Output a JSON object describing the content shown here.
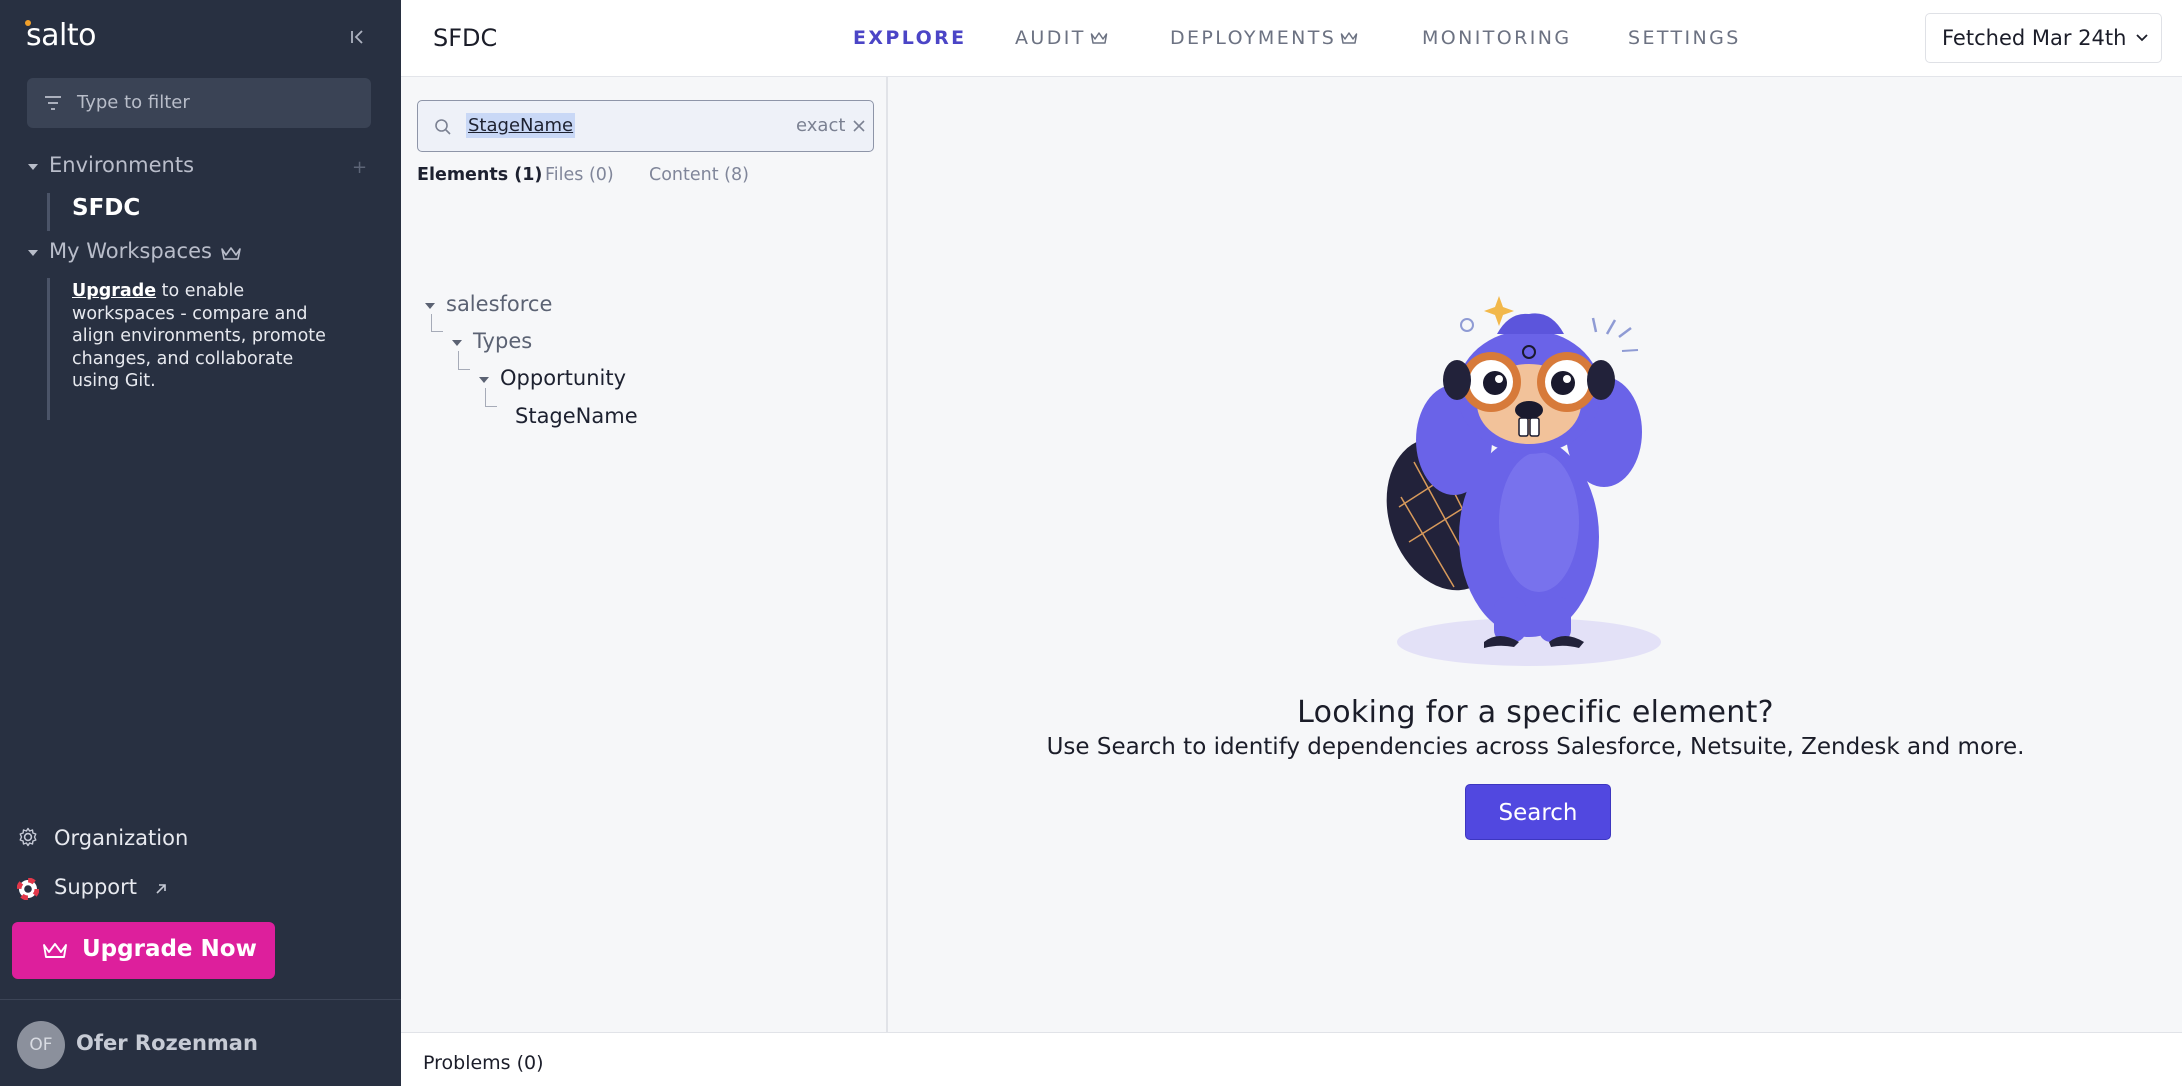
{
  "sidebar": {
    "logo_text": "salto",
    "filter_placeholder": "Type to filter",
    "environments_label": "Environments",
    "environments_add": "+",
    "environment_items": [
      "SFDC"
    ],
    "workspaces_label": "My Workspaces",
    "workspaces_note_link": "Upgrade",
    "workspaces_note_text": " to enable workspaces - compare and align environments, promote changes, and collaborate using Git.",
    "organization_label": "Organization",
    "support_label": "Support",
    "upgrade_label": "Upgrade Now",
    "user_initials": "OF",
    "user_name": "Ofer Rozenman"
  },
  "header": {
    "env_title": "SFDC",
    "nav": [
      {
        "label": "EXPLORE",
        "active": true,
        "crown": false
      },
      {
        "label": "AUDIT",
        "active": false,
        "crown": true
      },
      {
        "label": "DEPLOYMENTS",
        "active": false,
        "crown": true
      },
      {
        "label": "MONITORING",
        "active": false,
        "crown": false
      },
      {
        "label": "SETTINGS",
        "active": false,
        "crown": false
      }
    ],
    "fetched_label": "Fetched Mar 24th"
  },
  "search": {
    "value": "StageName",
    "mode": "exact",
    "tabs": [
      {
        "label": "Elements (1)",
        "active": true
      },
      {
        "label": "Files (0)",
        "active": false
      },
      {
        "label": "Content (8)",
        "active": false
      }
    ],
    "tree": [
      {
        "label": "salesforce",
        "depth": 0,
        "expanded": true
      },
      {
        "label": "Types",
        "depth": 1,
        "expanded": true
      },
      {
        "label": "Opportunity",
        "depth": 2,
        "expanded": true
      },
      {
        "label": "StageName",
        "depth": 3,
        "expanded": false
      }
    ]
  },
  "main": {
    "headline": "Looking for a specific element?",
    "subline": "Use Search to identify dependencies across Salesforce, Netsuite, Zendesk and more.",
    "search_button": "Search"
  },
  "footer": {
    "problems_label": "Problems (0)"
  },
  "colors": {
    "sidebar_bg": "#283041",
    "accent": "#5148e0",
    "upgrade": "#dd1f9c",
    "nav_active": "#4b45c6"
  }
}
